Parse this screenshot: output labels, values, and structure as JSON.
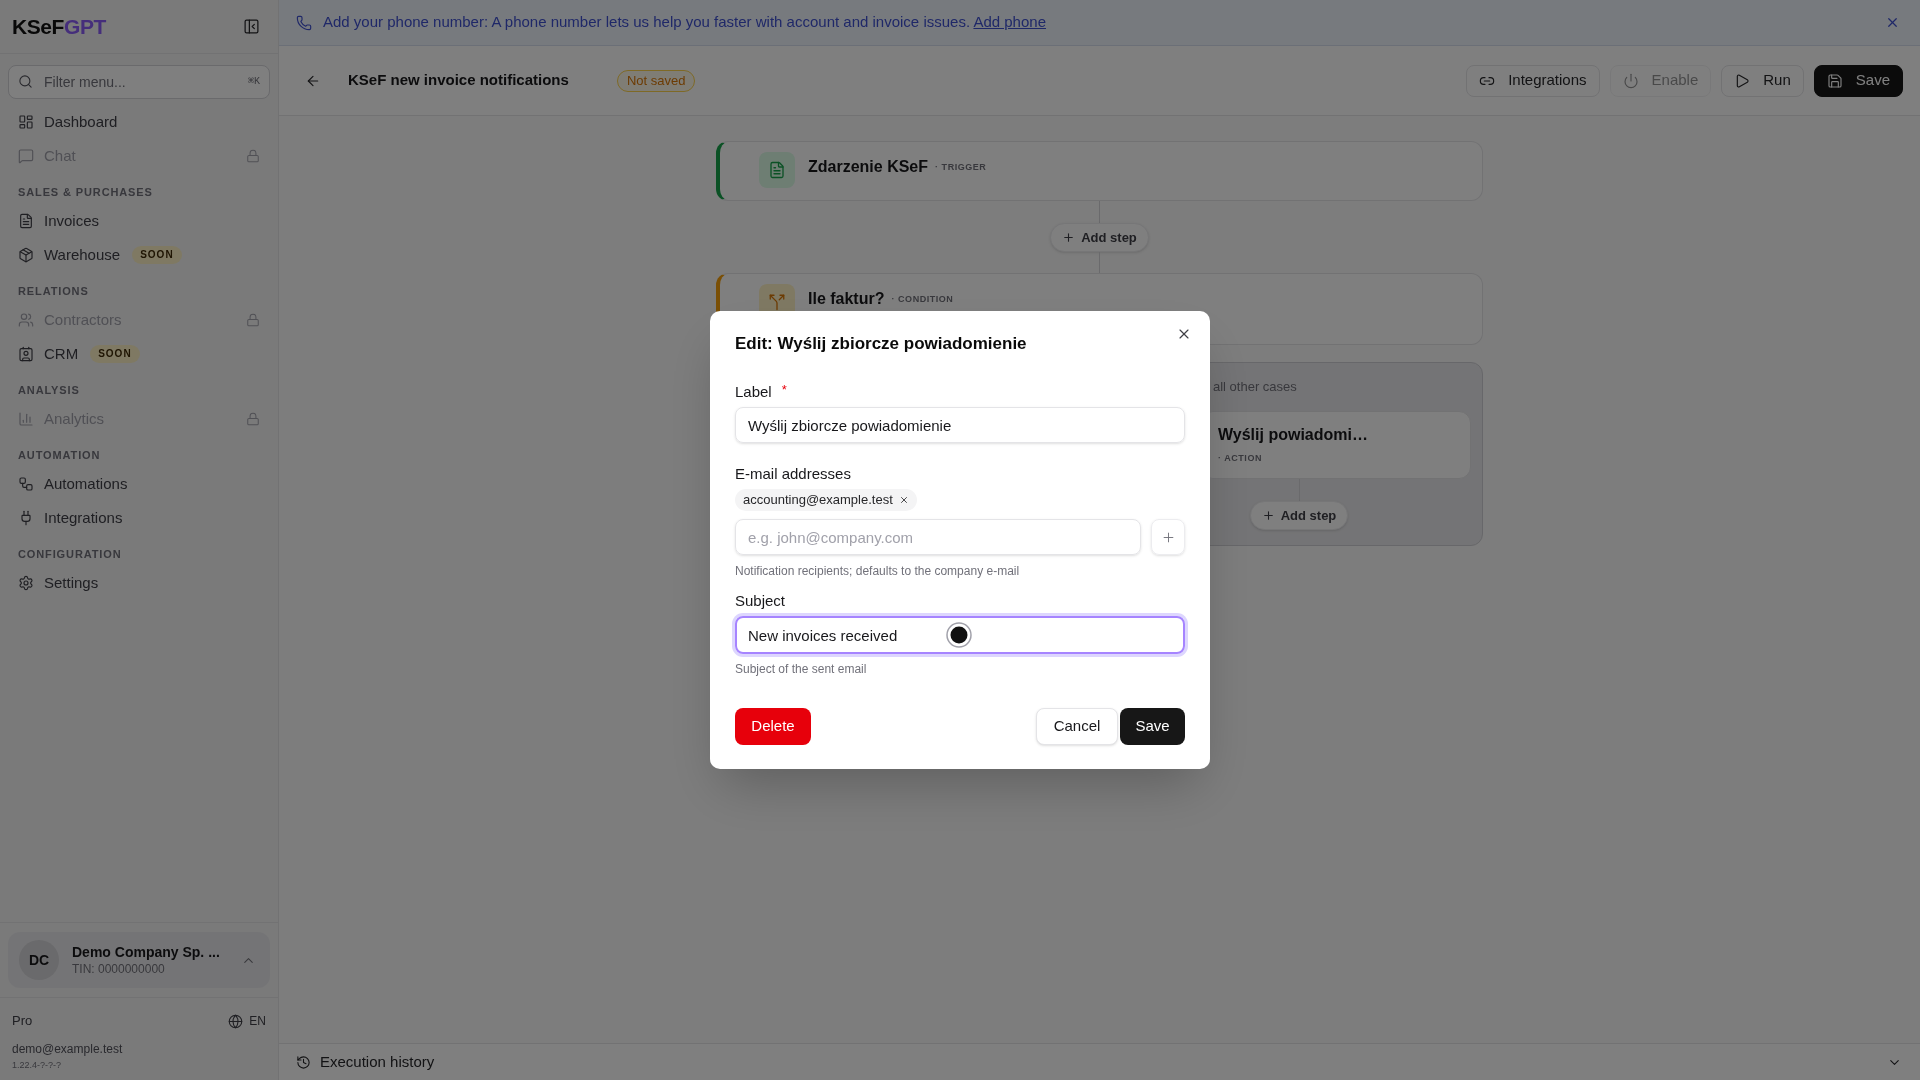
{
  "banner": {
    "message": "Add your phone number: A phone number lets us help you faster with account and invoice issues.",
    "link": "Add phone"
  },
  "sidebar": {
    "logo": {
      "part_1": "KSeF",
      "part_2": "GPT"
    },
    "filter": {
      "placeholder": "Filter menu...",
      "shortcut": "⌘K"
    },
    "sections": [
      {
        "items": [
          {
            "label": "Dashboard",
            "locked": false
          },
          {
            "label": "Chat",
            "locked": true
          }
        ]
      },
      {
        "heading": "SALES & PURCHASES",
        "items": [
          {
            "label": "Invoices",
            "locked": false
          },
          {
            "label": "Warehouse",
            "locked": false,
            "badge": "SOON"
          }
        ]
      },
      {
        "heading": "RELATIONS",
        "items": [
          {
            "label": "Contractors",
            "locked": true
          },
          {
            "label": "CRM",
            "locked": false,
            "badge": "SOON"
          }
        ]
      },
      {
        "heading": "ANALYSIS",
        "items": [
          {
            "label": "Analytics",
            "locked": true
          }
        ]
      },
      {
        "heading": "AUTOMATION",
        "items": [
          {
            "label": "Automations",
            "locked": false
          },
          {
            "label": "Integrations",
            "locked": false
          }
        ]
      },
      {
        "heading": "CONFIGURATION",
        "items": [
          {
            "label": "Settings",
            "locked": false
          }
        ]
      }
    ],
    "company": {
      "initials": "DC",
      "name": "Demo Company Sp. ...",
      "tax_id": "TIN: 0000000000"
    },
    "plan": "Pro",
    "language": "EN",
    "email": "demo@example.test",
    "version": "1.22.4-?-?-?"
  },
  "header": {
    "title": "KSeF new invoice notifications",
    "status": "Not saved",
    "actions": [
      {
        "label": "Integrations",
        "kind": "outline",
        "disabled": false
      },
      {
        "label": "Enable",
        "kind": "outline",
        "disabled": true
      },
      {
        "label": "Run",
        "kind": "outline",
        "disabled": false
      },
      {
        "label": "Save",
        "kind": "primary",
        "disabled": false
      }
    ]
  },
  "canvas": {
    "steps": [
      {
        "kind": "trigger",
        "title": "Zdarzenie KSeF",
        "type": "· TRIGGER"
      },
      {
        "kind": "add_step",
        "label": "Add step"
      },
      {
        "kind": "condition",
        "title": "Ile faktur?",
        "type": "· CONDITION"
      }
    ],
    "branch": {
      "label": "all other cases",
      "card": {
        "title": "Wyślij powiadomi…",
        "type": "· ACTION"
      },
      "add_step": "Add step"
    }
  },
  "dialog": {
    "title": "Edit: Wyślij zbiorcze powiadomienie",
    "label_field": {
      "label": "Label",
      "required_mark": "*",
      "value": "Wyślij zbiorcze powiadomienie"
    },
    "recipients": {
      "label": "E-mail addresses",
      "chips": [
        "accounting@example.test"
      ],
      "placeholder": "e.g. john@company.com",
      "hint": "Notification recipients; defaults to the company e-mail"
    },
    "subject": {
      "label": "Subject",
      "value": "New invoices received",
      "focused": true,
      "hint": "Subject of the sent email"
    },
    "buttons": {
      "delete": "Delete",
      "cancel": "Cancel",
      "save": "Save"
    }
  },
  "footer": {
    "label": "Execution history"
  }
}
